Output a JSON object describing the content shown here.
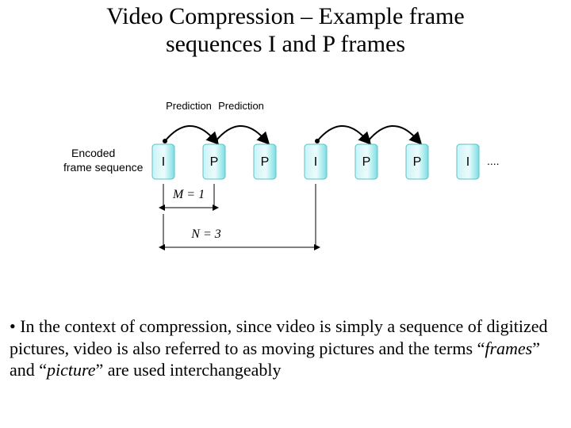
{
  "title_line1": "Video Compression – Example frame",
  "title_line2": "sequences I and P frames",
  "diagram": {
    "pred1": "Prediction",
    "pred2": "Prediction",
    "side_label_line1": "Encoded",
    "side_label_line2": "frame sequence",
    "frames": [
      "I",
      "P",
      "P",
      "I",
      "P",
      "P",
      "I"
    ],
    "ellipsis": "....",
    "m_label": "M = 1",
    "n_label": "N = 3"
  },
  "bullet": {
    "lead": "• In the context of compression, since video is simply a sequence of digitized pictures, video is also referred to as moving pictures and the terms ",
    "q1o": "“",
    "frames_word": "frames",
    "q1c": "”",
    "and": " and ",
    "q2o": "“",
    "picture_word": "picture",
    "q2c": "”",
    "tail": " are used interchangeably"
  }
}
